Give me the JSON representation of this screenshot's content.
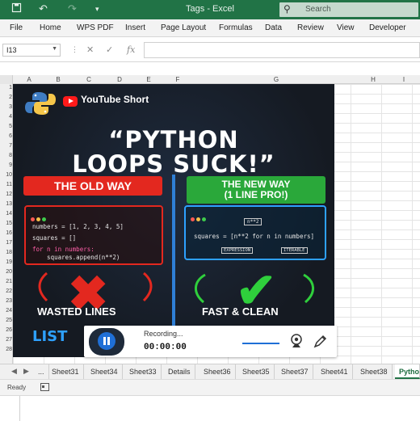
{
  "titlebar": {
    "title": "Tags  -  Excel",
    "search_placeholder": "Search"
  },
  "menu": [
    "File",
    "Home",
    "WPS PDF",
    "Insert",
    "Page Layout",
    "Formulas",
    "Data",
    "Review",
    "View",
    "Developer"
  ],
  "formula_bar": {
    "name_box": "I13",
    "cancel_icon": "close-icon",
    "enter_icon": "check-icon",
    "fx_label": "fx",
    "value": ""
  },
  "columns": [
    "A",
    "B",
    "C",
    "D",
    "E",
    "F",
    "G",
    "H",
    "I"
  ],
  "rows": [
    "1",
    "2",
    "3",
    "4",
    "5",
    "6",
    "7",
    "8",
    "9",
    "10",
    "11",
    "12",
    "13",
    "14",
    "15",
    "16",
    "17",
    "18",
    "19",
    "20",
    "21",
    "22",
    "23",
    "24",
    "25",
    "26",
    "27",
    "28"
  ],
  "thumbnail": {
    "brand": "YouTube Short",
    "headline_line1": "“PYTHON",
    "headline_line2": "LOOPS SUCK!”",
    "old_label": "THE OLD WAY",
    "new_label_1": "THE NEW WAY",
    "new_label_2": "(1 LINE PRO!)",
    "old_code_1": "numbers = [1, 2, 3, 4, 5]",
    "old_code_2": "squares = []",
    "old_code_3": "for n in numbers:",
    "old_code_4": "    squares.append(n**2)",
    "new_code": "squares = [n**2 for n in numbers]",
    "new_tag_top": "n**2",
    "new_tag_expr": "EXPRESSION",
    "new_tag_iter": "ITERABLE",
    "caption_left": "WASTED LINES",
    "caption_right": "FAST & CLEAN",
    "bottom_word": "LIST"
  },
  "recording": {
    "label": "Recording...",
    "time": "00:00:00"
  },
  "sheet_tabs": [
    "...",
    "Sheet31",
    "Sheet34",
    "Sheet33",
    "Details",
    "Sheet36",
    "Sheet35",
    "Sheet37",
    "Sheet41",
    "Sheet38",
    "Pytho"
  ],
  "active_tab": "Pytho",
  "status": {
    "ready": "Ready"
  },
  "colors": {
    "excel_green": "#217346",
    "red": "#e3281f",
    "green": "#2aa83a",
    "blue": "#2ea1ff"
  }
}
